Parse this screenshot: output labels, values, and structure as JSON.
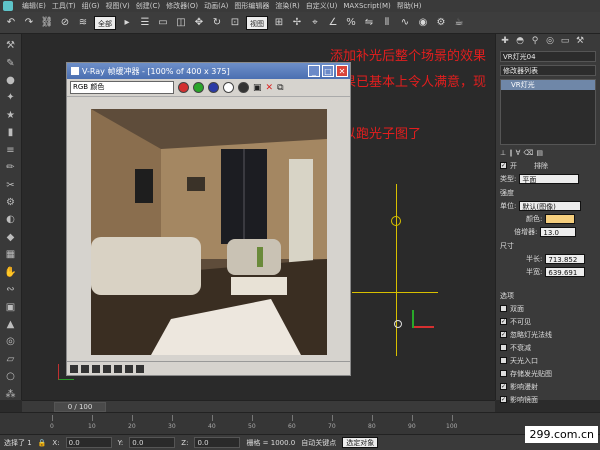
{
  "menu": {
    "items": [
      "编辑(E)",
      "工具(T)",
      "组(G)",
      "视图(V)",
      "创建(C)",
      "修改器(O)",
      "动画(A)",
      "图形编辑器",
      "渲染(R)",
      "自定义(U)",
      "MAXScript(M)",
      "帮助(H)"
    ]
  },
  "toolbar": {
    "filter_select": "全部",
    "ref_coord": "视图"
  },
  "viewport": {
    "label": ""
  },
  "annotation": {
    "line1": "添加补光后整个场景的效果",
    "line2": "效果已基本上令人满意，现在",
    "line3": "可以跑光子图了"
  },
  "frame_buffer": {
    "title": "V-Ray 帧缓冲器 - [100% of 400 x 375]",
    "channel": "RGB 颜色"
  },
  "command_panel": {
    "object_name": "VR灯光04",
    "modifier_list": "修改器列表",
    "stack_item": "VR灯光",
    "on_label": "开",
    "exclude_label": "排除",
    "type_label": "类型:",
    "type_value": "平面",
    "intensity_section": "强度",
    "units_label": "单位:",
    "units_value": "默认(图像)",
    "color_label": "颜色:",
    "multiplier_label": "倍增器:",
    "multiplier_value": "13.0",
    "size_section": "尺寸",
    "half_length_label": "半长:",
    "half_length_value": "713.852",
    "half_width_label": "半宽:",
    "half_width_value": "639.691",
    "options_section": "选项",
    "options": [
      {
        "label": "双面",
        "checked": false
      },
      {
        "label": "不可见",
        "checked": true
      },
      {
        "label": "忽略灯光法线",
        "checked": true
      },
      {
        "label": "不衰减",
        "checked": false
      },
      {
        "label": "天光入口",
        "checked": false
      },
      {
        "label": "存储发光贴图",
        "checked": false
      },
      {
        "label": "影响漫射",
        "checked": true
      },
      {
        "label": "影响镜面",
        "checked": true
      }
    ]
  },
  "timeline": {
    "frame": "0 / 100",
    "ticks": [
      "0",
      "10",
      "20",
      "30",
      "40",
      "50",
      "60",
      "70",
      "80",
      "90",
      "100"
    ]
  },
  "status": {
    "selected": "选择了 1",
    "x_label": "X:",
    "x_value": "0.0",
    "y_label": "Y:",
    "y_value": "0.0",
    "z_label": "Z:",
    "z_value": "0.0",
    "grid": "栅格 = 1000.0",
    "autokey": "自动关键点",
    "selection_set": "选定对象"
  },
  "watermark": "299.com.cn"
}
